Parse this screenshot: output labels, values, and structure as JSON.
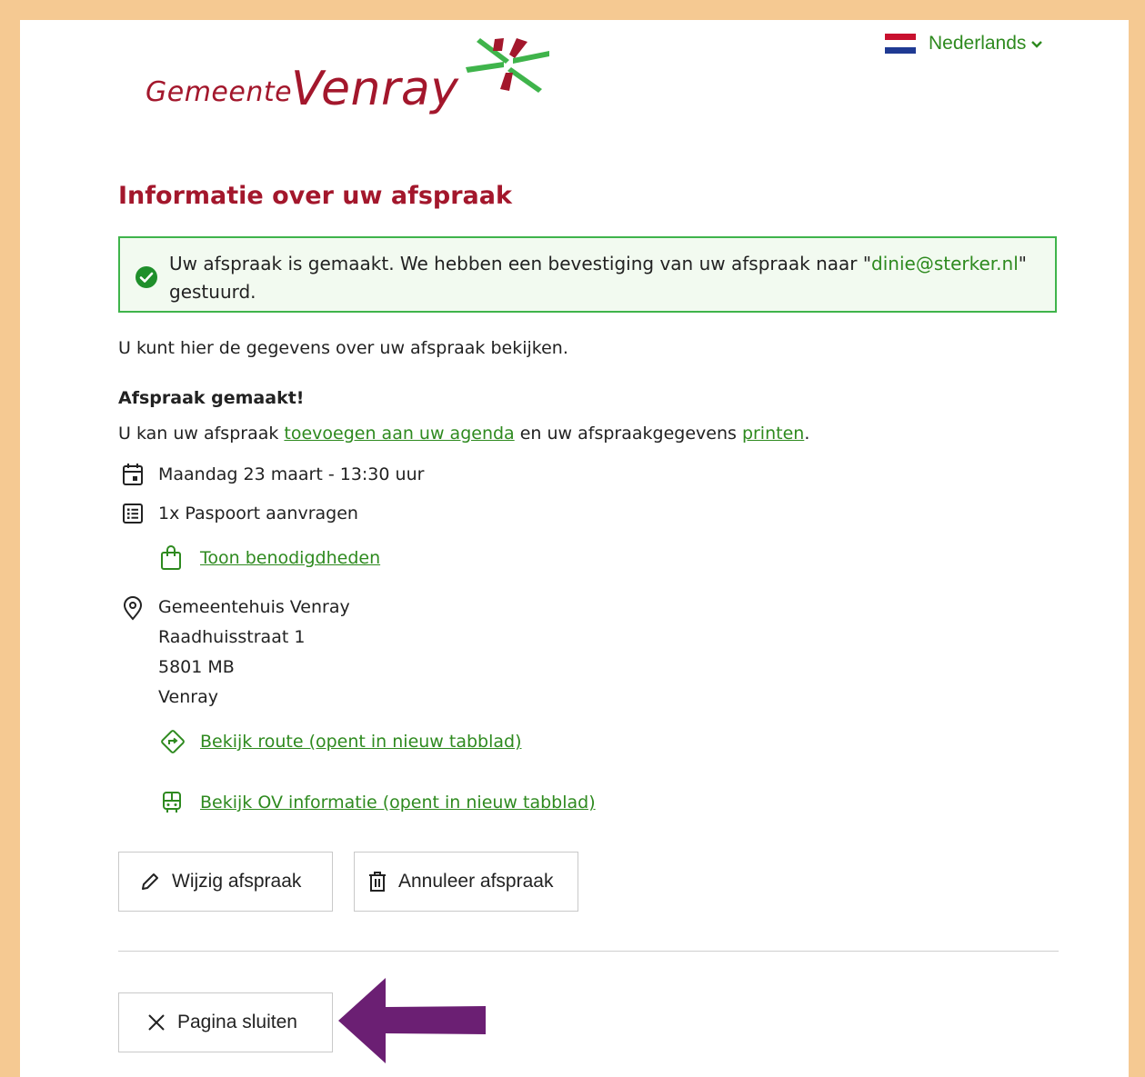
{
  "header": {
    "language": {
      "label": "Nederlands",
      "flag": "nl-flag-icon",
      "chevron": "chevron-down-icon"
    },
    "logo": {
      "text_small": "Gemeente",
      "text_large": "Venray"
    }
  },
  "page": {
    "title": "Informatie over uw afspraak",
    "alert": {
      "text_before": "Uw afspraak is gemaakt. We hebben een bevestiging van uw afspraak naar \"",
      "email": "dinie@sterker.nl",
      "text_after": "\" gestuurd."
    },
    "intro": "U kunt hier de gegevens over uw afspraak bekijken.",
    "made_heading": "Afspraak gemaakt!",
    "made_line": {
      "before": "U kan uw afspraak ",
      "agenda_link": "toevoegen aan uw agenda",
      "middle": " en uw afspraakgegevens ",
      "print_link": "printen",
      "after": "."
    },
    "datetime": "Maandag 23 maart - 13:30 uur",
    "product": "1x Paspoort aanvragen",
    "requirements_link": "Toon benodigdheden",
    "location": {
      "name": "Gemeentehuis Venray",
      "street": "Raadhuisstraat 1",
      "postcode": "5801 MB",
      "city": "Venray"
    },
    "route_link": "Bekijk route (opent in nieuw tabblad)",
    "ov_link": "Bekijk OV informatie (opent in nieuw tabblad)",
    "buttons": {
      "edit": "Wijzig afspraak",
      "cancel": "Annuleer afspraak",
      "close": "Pagina sluiten"
    }
  },
  "colors": {
    "brand_red": "#a3172c",
    "link_green": "#2e8a1f",
    "alert_border": "#3fb44b",
    "frame": "#f5c992",
    "annotation_arrow": "#6b1f73"
  }
}
